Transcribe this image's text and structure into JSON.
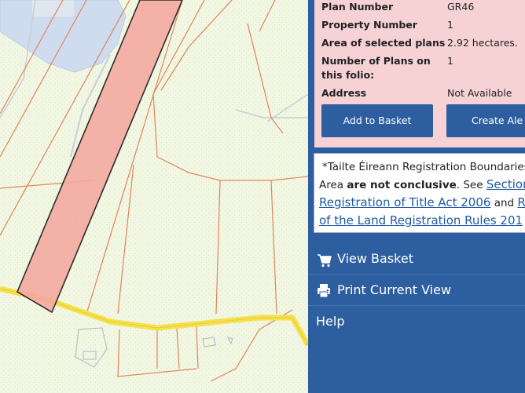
{
  "property_info": {
    "rows": [
      {
        "label": "Plan Number",
        "value": "GR46"
      },
      {
        "label": "Property Number",
        "value": "1"
      },
      {
        "label": "Area of selected plans",
        "value": "2.92 hectares."
      },
      {
        "label": "Number of Plans on",
        "label2": "this folio:",
        "value": "1"
      },
      {
        "label": "Address",
        "value": "Not Available"
      }
    ],
    "add_to_basket": "Add to Basket",
    "create_alert": "Create Ale"
  },
  "notice": {
    "line1": "*Tailte Éireann Registration Boundaries",
    "line2_pre": "Area ",
    "line2_bold": "are not conclusive",
    "line2_mid": ". See ",
    "line2_link": "Section",
    "line3_link": "Registration of Title Act 2006",
    "line3_mid": " and ",
    "line3_link2": "R",
    "line4_link": "of the Land Registration Rules 201"
  },
  "menu": {
    "view_basket": "View Basket",
    "print_view": "Print Current View",
    "help": "Help"
  },
  "colors": {
    "panel_blue": "#2d5ea0",
    "info_pink": "#f6d2d5",
    "selected_plot": "#f4a9a0",
    "road_yellow": "#f5e14b",
    "boundary_orange": "#e0855a"
  }
}
